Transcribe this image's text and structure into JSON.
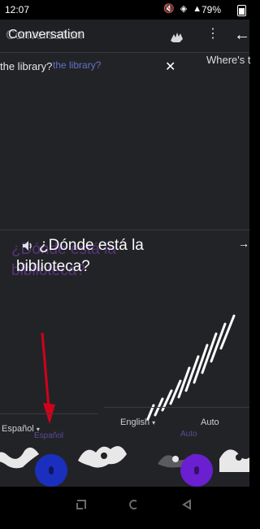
{
  "status_bar": {
    "time": "12:07",
    "icons": "🔇 ◈ ▲",
    "battery": "79%"
  },
  "app_bar": {
    "title": "Conversation",
    "menu_glyph": "⋮",
    "back_glyph": "←"
  },
  "conversation": {
    "source_text": "the library?",
    "source_ghost": "the library?",
    "right_ghost": "Where's t",
    "close_glyph": "✕",
    "translation": "¿Dónde está la biblioteca?",
    "translation_ghost": "¿Dónde está la biblioteca?",
    "arrow_glyph": "→"
  },
  "languages": {
    "left": "Español",
    "middle": "English",
    "right": "Auto",
    "caret": "▾",
    "ghost_left": "Español",
    "ghost_right": "Auto"
  },
  "colors": {
    "background": "#222327",
    "mic_spanish": "#1b2fbf",
    "mic_auto": "#6a1fd1",
    "red_arrow": "#d0021b"
  }
}
